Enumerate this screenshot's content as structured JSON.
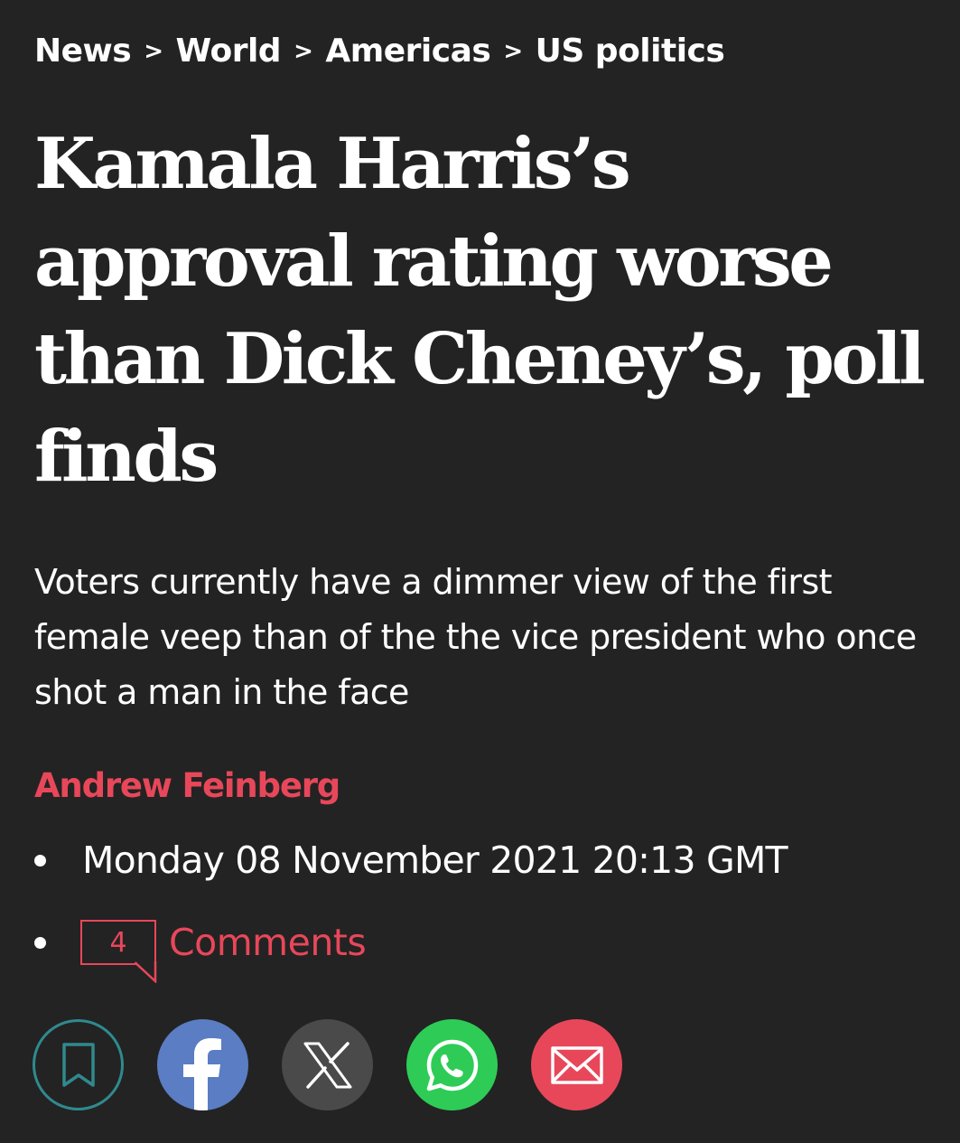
{
  "breadcrumb": {
    "items": [
      "News",
      "World",
      "Americas",
      "US politics"
    ],
    "separator": ">"
  },
  "article": {
    "headline": "Kamala Harris’s approval rating worse than Dick Cheney’s, poll finds",
    "standfirst": "Voters currently have a dimmer view of the first female veep than of the the vice president who once shot a man in the face",
    "author": "Andrew Feinberg",
    "date": "Monday 08 November 2021 20:13 GMT",
    "comments_count": "4",
    "comments_label": "Comments"
  },
  "share": {
    "buttons": [
      {
        "icon": "bookmark-icon",
        "color": "#2f8a8e"
      },
      {
        "icon": "facebook-icon",
        "color": "#5a7dc4"
      },
      {
        "icon": "x-icon",
        "color": "#4a4a4a"
      },
      {
        "icon": "whatsapp-icon",
        "color": "#2ecc56"
      },
      {
        "icon": "email-icon",
        "color": "#e8475a"
      }
    ]
  },
  "colors": {
    "background": "#232323",
    "text": "#ffffff",
    "accent": "#e8475a"
  }
}
